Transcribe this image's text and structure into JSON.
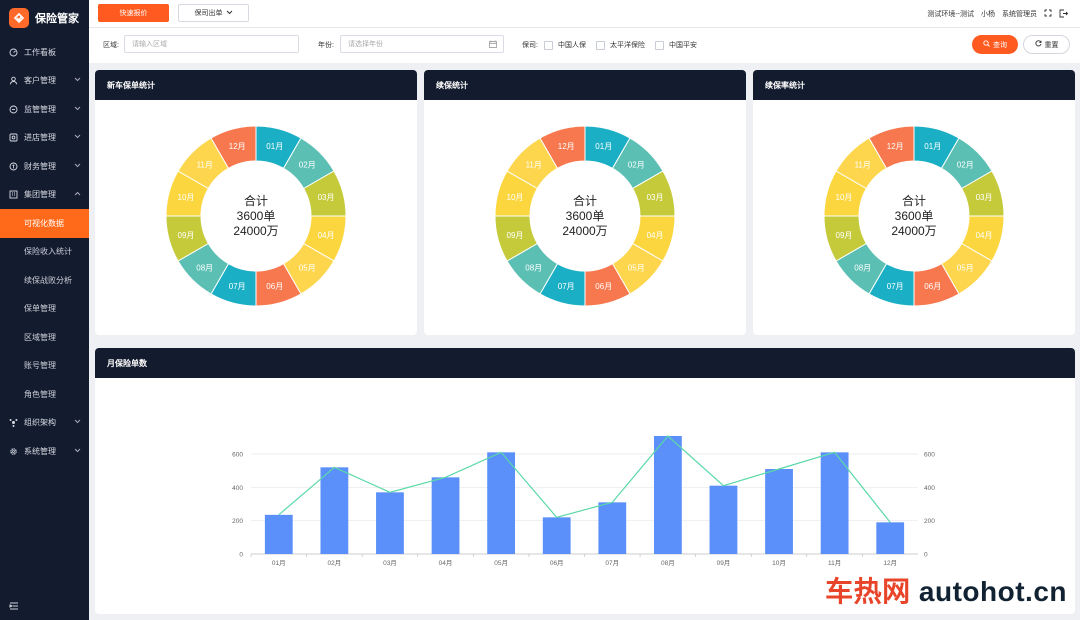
{
  "brand": {
    "name": "保险管家"
  },
  "sidebar": {
    "items": [
      {
        "label": "工作看板",
        "icon": "dashboard-icon",
        "expandable": false
      },
      {
        "label": "客户管理",
        "icon": "user-icon",
        "expandable": true
      },
      {
        "label": "监管管理",
        "icon": "shield-icon",
        "expandable": true
      },
      {
        "label": "进店管理",
        "icon": "store-icon",
        "expandable": true
      },
      {
        "label": "财务管理",
        "icon": "finance-icon",
        "expandable": true
      },
      {
        "label": "集团管理",
        "icon": "building-icon",
        "expandable": true,
        "expanded": true
      }
    ],
    "sub_items": [
      "可视化数据",
      "保险收入统计",
      "续保战败分析",
      "保单管理",
      "区域管理",
      "账号管理",
      "角色管理"
    ],
    "active_sub": "可视化数据",
    "items_after": [
      {
        "label": "组织架构",
        "icon": "org-icon",
        "expandable": true
      },
      {
        "label": "系统管理",
        "icon": "gear-icon",
        "expandable": true
      }
    ]
  },
  "topbar": {
    "quick_quote": "快速报价",
    "company_dropdown": "保司出单",
    "env": "测试环境--测试",
    "user": "小杨",
    "role": "系统管理员"
  },
  "filters": {
    "region_label": "区域:",
    "region_placeholder": "请输入区域",
    "year_label": "年份:",
    "year_placeholder": "请选择年份",
    "company_label": "保司:",
    "companies": [
      "中国人保",
      "太平洋保险",
      "中国平安"
    ],
    "query": "查询",
    "reset": "重置"
  },
  "colors": {
    "accent": "#ff5a1f",
    "sidebar_bg": "#131b2e",
    "bar": "#5b8ff9",
    "line": "#5ad8a6"
  },
  "donut_colors": [
    "#1aafc4",
    "#5bbfb3",
    "#c4ca3a",
    "#fcd63f",
    "#fdd64d",
    "#f7784f",
    "#1aafc4",
    "#5bbfb3",
    "#c4ca3a",
    "#fcd63f",
    "#fdd64d",
    "#f7784f"
  ],
  "donut_labels": [
    "01月",
    "02月",
    "03月",
    "04月",
    "05月",
    "06月",
    "07月",
    "08月",
    "09月",
    "10月",
    "11月",
    "12月"
  ],
  "cards": [
    {
      "title": "新车保单统计",
      "center_title": "合计",
      "center_count": "3600单",
      "center_amount": "24000万"
    },
    {
      "title": "续保统计",
      "center_title": "合计",
      "center_count": "3600单",
      "center_amount": "24000万"
    },
    {
      "title": "续保率统计",
      "center_title": "合计",
      "center_count": "3600单",
      "center_amount": "24000万"
    }
  ],
  "monthly": {
    "title": "月保险单数"
  },
  "chart_data": {
    "type": "bar",
    "categories": [
      "01月",
      "02月",
      "03月",
      "04月",
      "05月",
      "06月",
      "07月",
      "08月",
      "09月",
      "10月",
      "11月",
      "12月"
    ],
    "series": [
      {
        "type": "bar",
        "values": [
          235,
          520,
          370,
          460,
          610,
          220,
          310,
          710,
          410,
          510,
          610,
          190
        ]
      },
      {
        "type": "line",
        "values": [
          235,
          520,
          370,
          460,
          610,
          220,
          310,
          710,
          410,
          510,
          610,
          190
        ]
      }
    ],
    "ylim": [
      0,
      600
    ],
    "yticks": [
      0,
      200,
      400,
      600
    ],
    "y2ticks": [
      0,
      200,
      400,
      600
    ],
    "grid": true,
    "xlabel": "",
    "ylabel": ""
  },
  "watermark": {
    "cn": "车热网",
    "en": "autohot.cn"
  }
}
